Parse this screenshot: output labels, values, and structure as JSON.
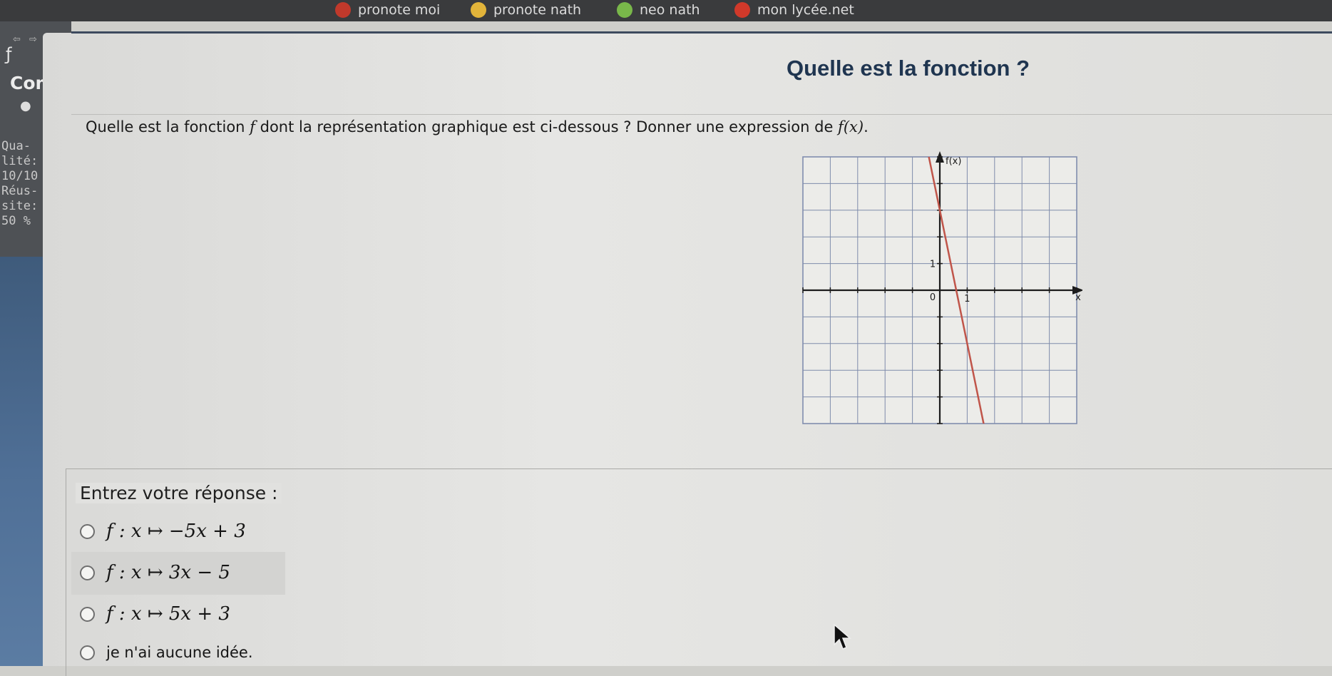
{
  "bookmarks": [
    {
      "label": "pronote moi",
      "icon": "pronote-icon",
      "color": "#c0392b"
    },
    {
      "label": "pronote nath",
      "icon": "pronote-icon",
      "color": "#e2b43a"
    },
    {
      "label": "neo nath",
      "icon": "neo-icon",
      "color": "#79b74a"
    },
    {
      "label": "mon lycée.net",
      "icon": "lycee-icon",
      "color": "#d0392a"
    }
  ],
  "sidebar": {
    "heading": "Com",
    "quality_label_1": "Qua-",
    "quality_label_2": "lité:",
    "quality_value": "10/10",
    "success_label_1": "Réus-",
    "success_label_2": "site:",
    "success_value": "50 %"
  },
  "exercise": {
    "title": "Quelle est la fonction ?",
    "question_part1": "Quelle est la fonction ",
    "question_f": "f",
    "question_part2": " dont la représentation graphique est ci-dessous ? Donner une expression de ",
    "question_fx": "f(x)",
    "question_end": "."
  },
  "chart_data": {
    "type": "line",
    "ylabel": "f(x)",
    "xlabel": "x",
    "tick_labels": {
      "origin": "0",
      "x_unit": "1",
      "y_unit": "1"
    },
    "xlim": [
      -5,
      5
    ],
    "ylim": [
      -5,
      5
    ],
    "grid": true,
    "series": [
      {
        "color": "#c0554a",
        "x": [
          -0.5,
          2.0
        ],
        "y": [
          5.5,
          -7.0
        ]
      }
    ]
  },
  "answer": {
    "legend": "Entrez votre réponse :",
    "options": [
      "f : x ↦ −5x + 3",
      "f : x ↦ 3x − 5",
      "f : x ↦ 5x + 3",
      "je n'ai aucune idée."
    ]
  }
}
